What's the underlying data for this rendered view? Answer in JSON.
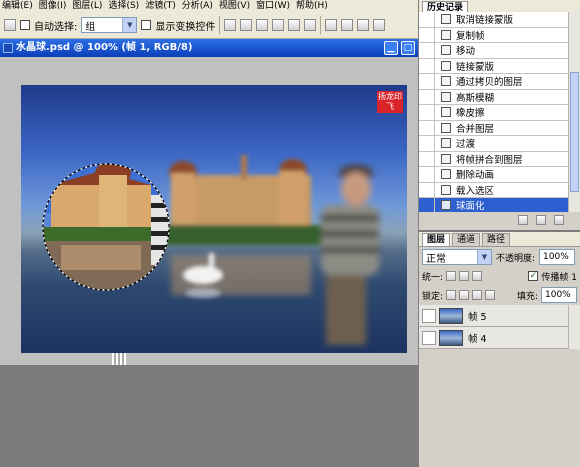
{
  "menubar": {
    "items": [
      "编辑(E)",
      "图像(I)",
      "图层(L)",
      "选择(S)",
      "滤镜(T)",
      "分析(A)",
      "视图(V)",
      "窗口(W)",
      "帮助(H)"
    ]
  },
  "options": {
    "auto_select_label": "自动选择:",
    "auto_select_value": "组",
    "show_transform_label": "显示变换控件"
  },
  "document": {
    "title": "水晶球.psd @ 100% (帧 1, RGB/8)",
    "stamp_text": "扬龙印飞"
  },
  "history": {
    "tab_label": "历史记录",
    "items": [
      {
        "label": "取消链接蒙版",
        "selected": false
      },
      {
        "label": "复制帧",
        "selected": false
      },
      {
        "label": "移动",
        "selected": false
      },
      {
        "label": "链接蒙版",
        "selected": false
      },
      {
        "label": "通过拷贝的图层",
        "selected": false
      },
      {
        "label": "高斯模糊",
        "selected": false
      },
      {
        "label": "橡皮擦",
        "selected": false
      },
      {
        "label": "合并图层",
        "selected": false
      },
      {
        "label": "过渡",
        "selected": false
      },
      {
        "label": "将帧拼合到图层",
        "selected": false
      },
      {
        "label": "删除动画",
        "selected": false
      },
      {
        "label": "载入选区",
        "selected": false
      },
      {
        "label": "球面化",
        "selected": true
      }
    ]
  },
  "layers": {
    "tabs": [
      "图层",
      "通道",
      "路径"
    ],
    "blend_mode": "正常",
    "opacity_label": "不透明度:",
    "opacity_value": "100%",
    "unify_label": "统一:",
    "propagate_label": "传播帧 1",
    "lock_label": "锁定:",
    "fill_label": "填充:",
    "fill_value": "100%",
    "rows": [
      {
        "label": "帧 5"
      },
      {
        "label": "帧 4"
      }
    ]
  }
}
